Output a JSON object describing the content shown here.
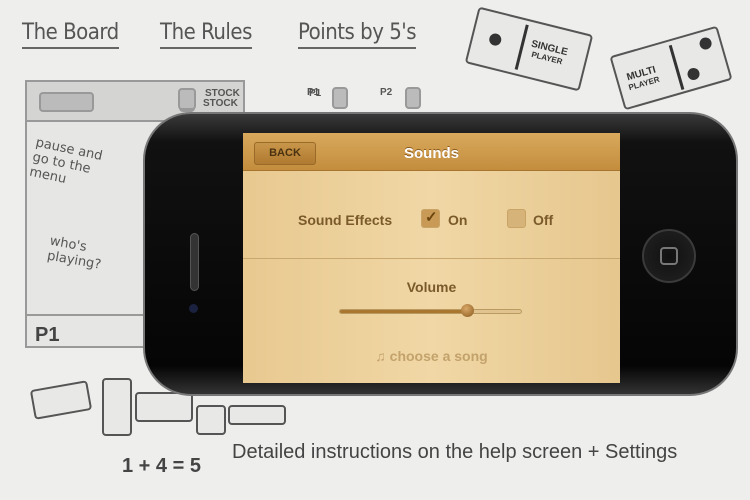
{
  "nav": {
    "board": "The Board",
    "rules": "The Rules",
    "points": "Points by 5's"
  },
  "dominoes": {
    "single": "SINGLE",
    "single_sub": "PLAYER",
    "multi": "MULTI",
    "multi_sub": "PLAYER"
  },
  "board": {
    "stock": "STOCK",
    "p1": "P1",
    "p2": "P2",
    "player": "P1",
    "note_pause": "pause and go to the menu",
    "note_who": "who's playing?",
    "equation": "1 + 4 = 5"
  },
  "screen": {
    "back": "BACK",
    "title": "Sounds",
    "sound_effects": "Sound Effects",
    "on": "On",
    "off": "Off",
    "on_checked": true,
    "volume": "Volume",
    "volume_level": 0.7,
    "song": "choose a song",
    "song_icon": "music-note-icon"
  },
  "caption": "Detailed instructions on the help screen + Settings"
}
